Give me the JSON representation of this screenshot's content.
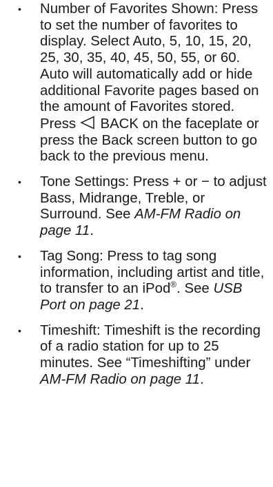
{
  "items": [
    {
      "seg1": "Number of Favorites Shown: Press to set the number of favorites to display. Select Auto, 5, 10, 15, 20, 25, 30, 35, 40, 45, 50, 55, or 60. Auto will automatically add or hide additional Favorite pages based on the amount of Favorites stored. Press",
      "seg2": "BACK on the faceplate or press the Back screen button to go back to the previous menu.",
      "icon": "back-triangle-icon"
    },
    {
      "seg1": "Tone Settings: Press + or − to adjust Bass, Midrange, Treble, or Surround. See",
      "ref": "AM-FM Radio on page 11",
      "seg2": "."
    },
    {
      "seg1": "Tag Song: Press to tag song information, including artist and title, to transfer to an iPod",
      "sup": "®",
      "seg2": ". See",
      "ref": "USB Port on page 21",
      "seg3": "."
    },
    {
      "seg1": "Timeshift: Timeshift is the recording of a radio station for up to 25 minutes. See “Timeshifting” under",
      "ref": "AM-FM Radio on page 11",
      "seg2": "."
    }
  ]
}
